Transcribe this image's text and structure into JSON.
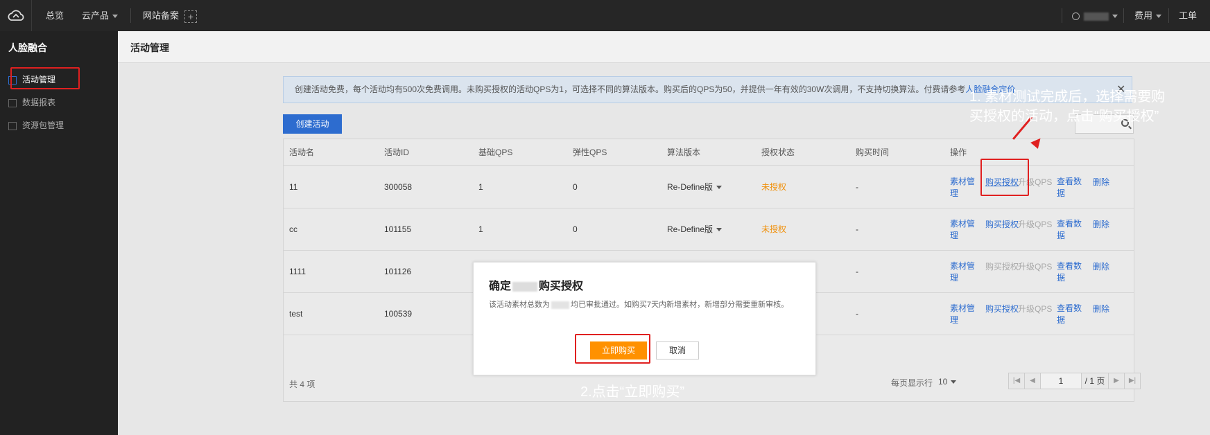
{
  "topbar": {
    "nav": {
      "overview": "总览",
      "products": "云产品",
      "icp": "网站备案",
      "plus": "+",
      "billing": "费用",
      "tickets": "工单"
    }
  },
  "sidebar": {
    "title": "人脸融合",
    "items": [
      {
        "label": "活动管理"
      },
      {
        "label": "数据报表"
      },
      {
        "label": "资源包管理"
      }
    ]
  },
  "page": {
    "title": "活动管理",
    "notice": "创建活动免费，每个活动均有500次免费调用。未购买授权的活动QPS为1，可选择不同的算法版本。购买后的QPS为50，并提供一年有效的30W次调用，不支持切换算法。付费请参考",
    "notice_link": "人脸融合定价",
    "create_button": "创建活动",
    "close": "✕"
  },
  "table": {
    "headers": [
      "活动名",
      "活动ID",
      "基础QPS",
      "弹性QPS",
      "算法版本",
      "授权状态",
      "购买时间",
      "操作"
    ],
    "rows": [
      {
        "name": "11",
        "id": "300058",
        "qps": "1",
        "elastic": "0",
        "version": "Re-Define版",
        "status": "未授权",
        "time": "-"
      },
      {
        "name": "cc",
        "id": "101155",
        "qps": "1",
        "elastic": "0",
        "version": "Re-Define版",
        "status": "未授权",
        "time": "-"
      },
      {
        "name": "1111",
        "id": "101126",
        "time": "-"
      },
      {
        "name": "test",
        "id": "100539",
        "time": "-"
      }
    ],
    "ops": {
      "material": "素材管理",
      "buy": "购买授权",
      "upgrade": "升级QPS",
      "view": "查看数据",
      "delete": "删除"
    },
    "footer": {
      "total": "共 4 项",
      "page_size_label": "每页显示行",
      "page_size": "10",
      "current_page": "1",
      "total_pages": "/ 1 页"
    }
  },
  "modal": {
    "title_prefix": "确定",
    "title_suffix": "购买授权",
    "body_prefix": "该活动素材总数为",
    "body_suffix": "均已审批通过。如购买7天内新增素材，新增部分需要重新审核。",
    "confirm": "立即购买",
    "cancel": "取消"
  },
  "annotations": {
    "step1": "1. 素材测试完成后，选择需要购买授权的活动，点击“购买授权”",
    "step2": "2.点击“立即购买”"
  },
  "colors": {
    "accent": "#2d6ccf",
    "warning": "#f0900a",
    "confirm": "#ff9100",
    "annotation": "#e02020"
  }
}
